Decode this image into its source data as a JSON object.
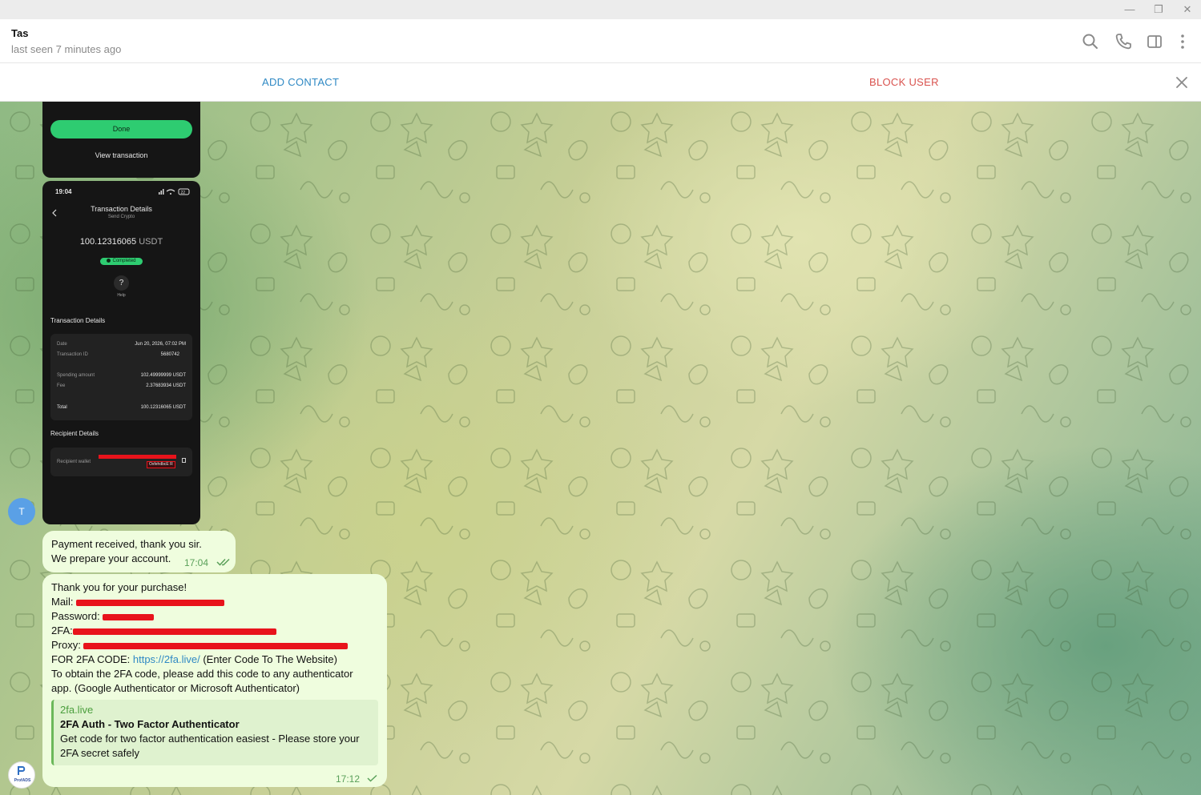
{
  "window": {
    "minimize": "—",
    "restore": "❐",
    "close": "✕"
  },
  "chat": {
    "name": "Tas",
    "status": "last seen 7 minutes ago"
  },
  "header_icons": [
    "search-icon",
    "phone-icon",
    "sidebar-toggle-icon",
    "more-vert-icon"
  ],
  "action_bar": {
    "add_contact": "ADD CONTACT",
    "block_user": "BLOCK USER"
  },
  "avatar_letter": "T",
  "screenshot1": {
    "done_label": "Done",
    "view_label": "View transaction"
  },
  "screenshot2": {
    "status_time": "19:04",
    "battery": "22",
    "title": "Transaction Details",
    "subtitle": "Send Crypto",
    "amount": "100.12316065",
    "currency": "USDT",
    "status_badge": "Completed",
    "help_label": "Help",
    "section1": "Transaction Details",
    "rows1": [
      {
        "label": "Date",
        "value": "Jun 20, 2026, 07:02 PM"
      },
      {
        "label": "Transaction ID",
        "value": "5680742"
      }
    ],
    "rows2": [
      {
        "label": "Spending amount",
        "value": "102.49999999 USDT"
      },
      {
        "label": "Fee",
        "value": "2.37683934 USDT"
      }
    ],
    "total_label": "Total",
    "total_value": "100.12316065 USDT",
    "section2": "Recipient Details",
    "recipient_label": "Recipient wallet",
    "recipient_value": "OxfehdbcE R"
  },
  "msg1": {
    "line1": "Payment received, thank you sir.",
    "line2": "We prepare your account.",
    "time": "17:04"
  },
  "msg2": {
    "line1": "Thank you for your purchase!",
    "mail_label": "Mail:",
    "password_label": "Password:",
    "twofa_label": "2FA:",
    "proxy_label": "Proxy:",
    "code_prefix": "FOR 2FA CODE:",
    "code_link": "https://2fa.live/",
    "code_suffix": "(Enter Code To The Website)",
    "info1": "To obtain the 2FA code, please add this code to any authenticator",
    "info2": "app. (Google Authenticator or Microsoft Authenticator)",
    "preview_site": "2fa.live",
    "preview_title": "2FA Auth - Two Factor Authenticator",
    "preview_desc1": "Get code for two factor authentication easiest - Please store your",
    "preview_desc2": "2FA secret safely",
    "time": "17:12"
  },
  "bottom_avatar": {
    "name": "ProfADS"
  },
  "colors": {
    "accent": "#2f89c4",
    "danger": "#d9534f",
    "bubble": "#effdde",
    "done_green": "#2ecc71"
  }
}
